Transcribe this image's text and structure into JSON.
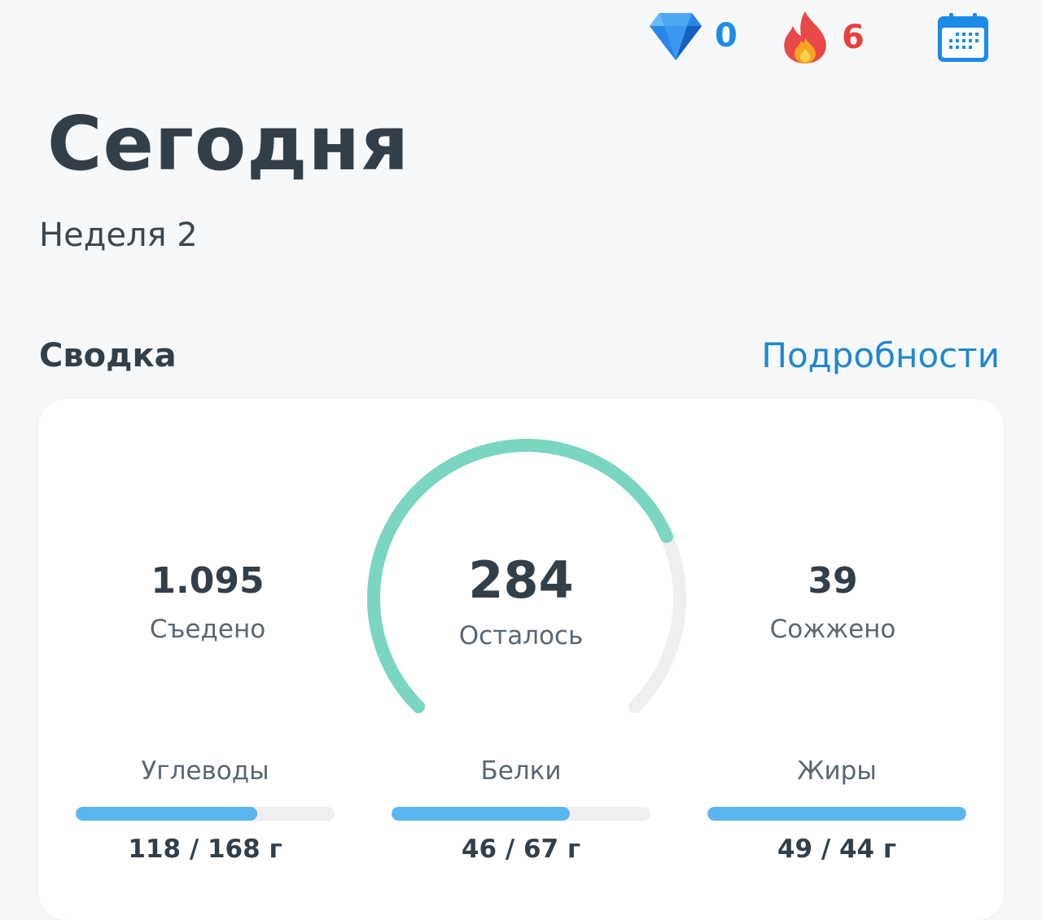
{
  "topbar": {
    "gems": {
      "icon": "diamond-icon",
      "value": "0"
    },
    "streak": {
      "icon": "flame-icon",
      "value": "6"
    },
    "calendar": {
      "icon": "calendar-icon"
    }
  },
  "header": {
    "title": "Сегодня",
    "subtitle": "Неделя 2"
  },
  "summary": {
    "title": "Сводка",
    "details_link": "Подробности",
    "eaten": {
      "value": "1.095",
      "label": "Съедено"
    },
    "remaining": {
      "value": "284",
      "label": "Осталось",
      "progress": 0.745
    },
    "burned": {
      "value": "39",
      "label": "Сожжено"
    },
    "macros": {
      "carbs": {
        "name": "Углеводы",
        "values": "118 / 168 г",
        "progress": 0.7
      },
      "protein": {
        "name": "Белки",
        "values": "46 / 67 г",
        "progress": 0.69
      },
      "fat": {
        "name": "Жиры",
        "values": "49 / 44 г",
        "progress": 1.0
      }
    }
  },
  "colors": {
    "gauge_fill": "#7ad6c1",
    "gauge_track": "#efefef",
    "bar_fill": "#5bb5ef",
    "link": "#1f87cf",
    "gems": "#1c8ce8",
    "streak": "#ea4040"
  }
}
